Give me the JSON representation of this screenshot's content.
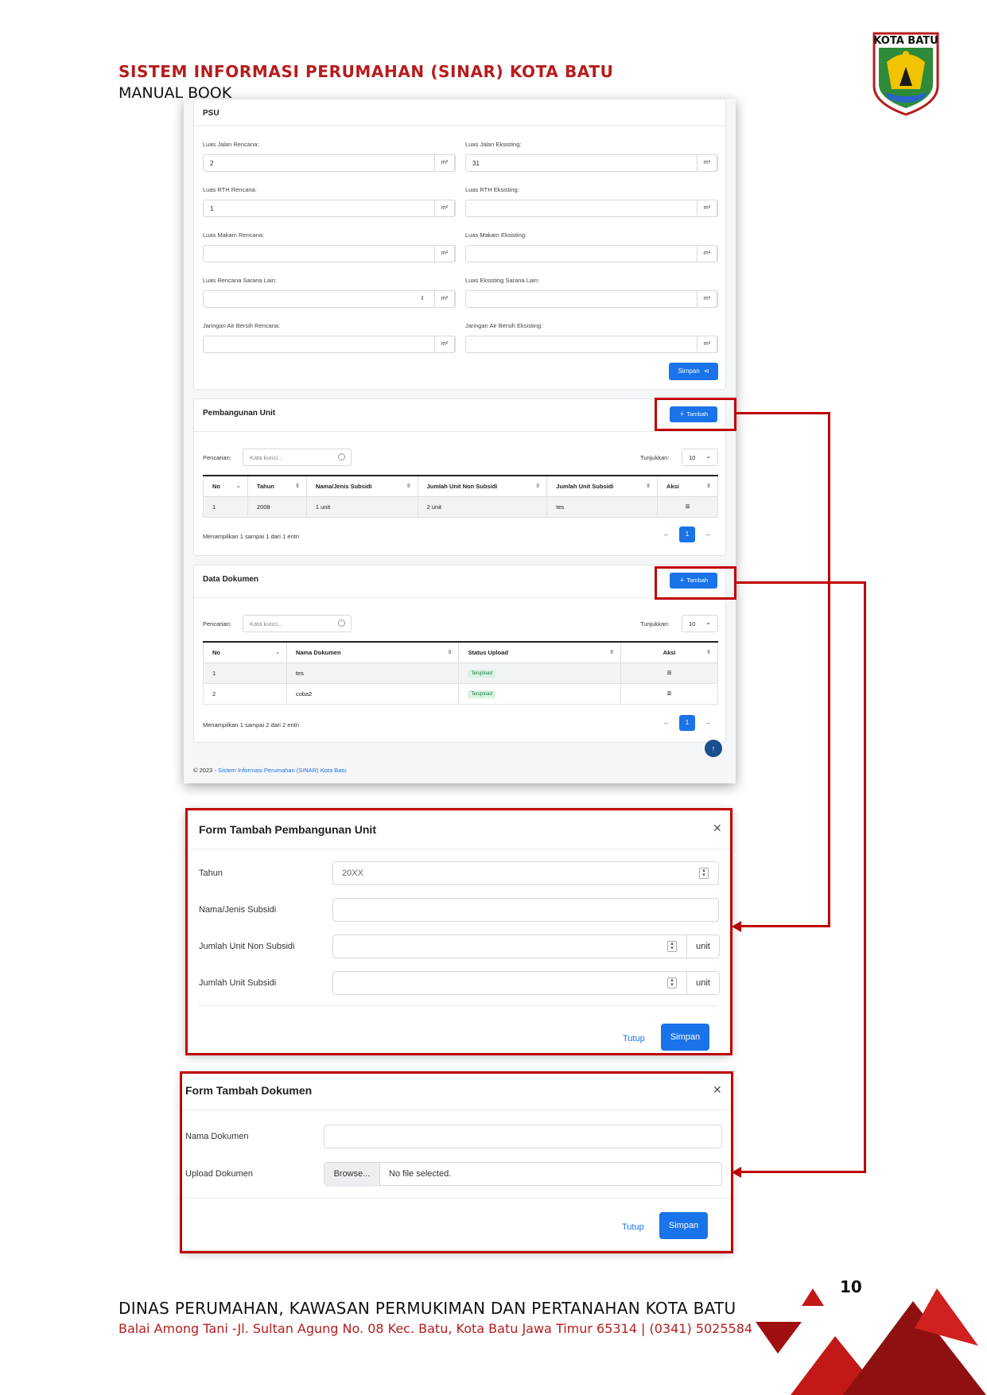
{
  "header": {
    "title": "SISTEM INFORMASI PERUMAHAN (SINAR) KOTA BATU",
    "subtitle": "MANUAL BOOK",
    "logo_text": "KOTA BATU"
  },
  "psu": {
    "title": "PSU",
    "unit": "m²",
    "fields": [
      {
        "label": "Luas Jalan Rencana:",
        "value": "2"
      },
      {
        "label": "Luas Jalan Eksisting:",
        "value": "31"
      },
      {
        "label": "Luas RTH Rencana:",
        "value": "1"
      },
      {
        "label": "Luas RTH Eksisting:",
        "value": ""
      },
      {
        "label": "Luas Makam Rencana:",
        "value": ""
      },
      {
        "label": "Luas Makam Eksisting:",
        "value": ""
      },
      {
        "label": "Luas Rencana Sarana Lain:",
        "value": ""
      },
      {
        "label": "Luas Eksisting Sarana Lain:",
        "value": ""
      },
      {
        "label": "Jaringan Air Bersih Rencana:",
        "value": ""
      },
      {
        "label": "Jaringan Air Bersih Eksisting:",
        "value": ""
      }
    ],
    "save_label": "Simpan"
  },
  "common": {
    "add_label": "Tambah",
    "search_label": "Pencarian:",
    "search_placeholder": "Kata kunci...",
    "show_label": "Tunjukkan:",
    "show_value": "10",
    "page": "1",
    "prev": "←",
    "next": "→"
  },
  "unit_section": {
    "title": "Pembangunan Unit",
    "columns": [
      "No",
      "Tahun",
      "Nama/Jenis Subsidi",
      "Jumlah Unit Non Subsidi",
      "Jumlah Unit Subsidi",
      "Aksi"
    ],
    "rows": [
      {
        "no": "1",
        "tahun": "2008",
        "nama": "1 unit",
        "non_subsidi": "2 unit",
        "subsidi": "tes"
      }
    ],
    "entries": "Menampilkan 1 sampai 1 dari 1 entri"
  },
  "doc_section": {
    "title": "Data Dokumen",
    "columns": [
      "No",
      "Nama Dokumen",
      "Status Upload",
      "Aksi"
    ],
    "rows": [
      {
        "no": "1",
        "nama": "tes",
        "status": "Terupload"
      },
      {
        "no": "2",
        "nama": "coba2",
        "status": "Terupload"
      }
    ],
    "entries": "Menampilkan 1 sampai 2 dari 2 entri"
  },
  "shot_footer": {
    "prefix": "© 2023 - ",
    "link": "Sistem Informasi Perumahan (SINAR) Kota Batu"
  },
  "modal_unit": {
    "title": "Form Tambah Pembangunan Unit",
    "labels": [
      "Tahun",
      "Nama/Jenis Subsidi",
      "Jumlah Unit Non Subsidi",
      "Jumlah Unit Subsidi"
    ],
    "tahun_placeholder": "20XX",
    "unit": "unit",
    "close_label": "Tutup",
    "save_label": "Simpan"
  },
  "modal_doc": {
    "title": "Form Tambah Dokumen",
    "labels": [
      "Nama Dokumen",
      "Upload Dokumen"
    ],
    "browse": "Browse...",
    "no_file": "No file selected.",
    "close_label": "Tutup",
    "save_label": "Simpan"
  },
  "footer": {
    "org": "DINAS PERUMAHAN, KAWASAN PERMUKIMAN DAN PERTANAHAN KOTA BATU",
    "address": "Balai Among Tani -Jl. Sultan Agung No. 08 Kec. Batu, Kota Batu Jawa Timur 65314 | (0341) 5025584",
    "page_number": "10"
  },
  "colors": {
    "primary": "#1a73e8",
    "accent_red": "#c00000",
    "title_red": "#b71c1c"
  }
}
